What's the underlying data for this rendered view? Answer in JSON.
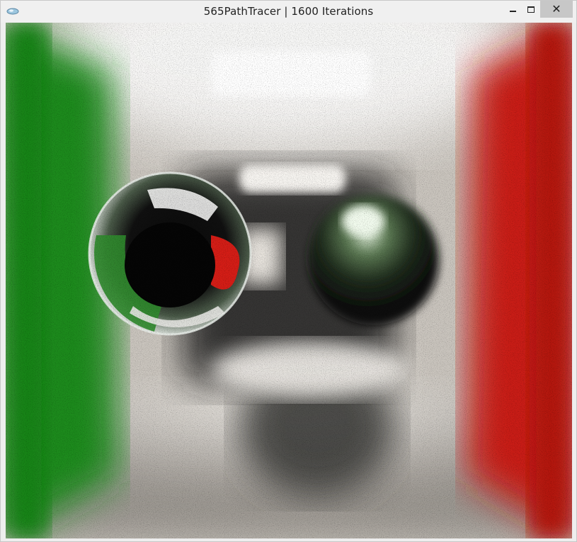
{
  "window": {
    "title": "565PathTracer | 1600 Iterations",
    "app_icon": "cornell-box-app-icon",
    "controls": {
      "minimize_icon": "minimize-icon",
      "maximize_icon": "maximize-icon",
      "close_glyph": "✕"
    }
  },
  "render": {
    "scene": "cornell-box",
    "colors": {
      "left_wall": "#1f8a1f",
      "right_wall": "#c81c14",
      "back_wall": "#bdb7af",
      "light": "#ffffff",
      "sphere_shadow": "#050505"
    }
  }
}
